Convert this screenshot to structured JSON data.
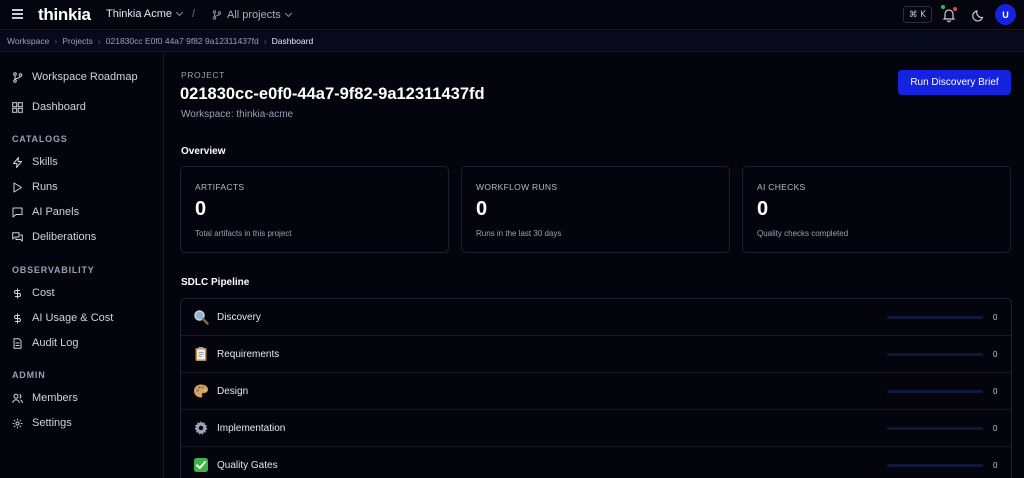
{
  "topbar": {
    "logo": "thinkia",
    "workspace": "Thinkia Acme",
    "separator": "/",
    "project_switch": "All projects",
    "shortcut": "⌘ K",
    "avatar": "U"
  },
  "breadcrumb": [
    "Workspace",
    "Projects",
    "021830cc E0f0 44a7 9f82 9a12311437fd",
    "Dashboard"
  ],
  "sidebar": {
    "top_items": [
      {
        "label": "Workspace Roadmap",
        "icon": "branch-icon"
      },
      {
        "label": "Dashboard",
        "icon": "dashboard-icon"
      }
    ],
    "sections": [
      {
        "heading": "CATALOGS",
        "items": [
          {
            "label": "Skills",
            "icon": "bolt-icon"
          },
          {
            "label": "Runs",
            "icon": "play-icon"
          },
          {
            "label": "AI Panels",
            "icon": "chat-icon"
          },
          {
            "label": "Deliberations",
            "icon": "chat-multi-icon"
          }
        ]
      },
      {
        "heading": "OBSERVABILITY",
        "items": [
          {
            "label": "Cost",
            "icon": "dollar-icon"
          },
          {
            "label": "AI Usage & Cost",
            "icon": "dollar-icon"
          },
          {
            "label": "Audit Log",
            "icon": "document-icon"
          }
        ]
      },
      {
        "heading": "ADMIN",
        "items": [
          {
            "label": "Members",
            "icon": "users-icon"
          },
          {
            "label": "Settings",
            "icon": "gear-icon"
          }
        ]
      }
    ]
  },
  "main": {
    "eyebrow": "PROJECT",
    "title": "021830cc-e0f0-44a7-9f82-9a12311437fd",
    "workspace_line": "Workspace: thinkia-acme",
    "run_button": "Run Discovery Brief",
    "overview_heading": "Overview",
    "cards": [
      {
        "label": "ARTIFACTS",
        "value": "0",
        "sub": "Total artifacts in this project"
      },
      {
        "label": "WORKFLOW RUNS",
        "value": "0",
        "sub": "Runs in the last 30 days"
      },
      {
        "label": "AI CHECKS",
        "value": "0",
        "sub": "Quality checks completed"
      }
    ],
    "pipeline_heading": "SDLC Pipeline",
    "stages": [
      {
        "name": "Discovery",
        "icon": "magnifier-icon",
        "count": "0"
      },
      {
        "name": "Requirements",
        "icon": "clipboard-icon",
        "count": "0"
      },
      {
        "name": "Design",
        "icon": "palette-icon",
        "count": "0"
      },
      {
        "name": "Implementation",
        "icon": "gear-icon",
        "count": "0"
      },
      {
        "name": "Quality Gates",
        "icon": "check-mark-icon",
        "count": "0"
      }
    ]
  },
  "colors": {
    "accent": "#1522e0",
    "background": "#03040c",
    "border": "#1c2034"
  }
}
